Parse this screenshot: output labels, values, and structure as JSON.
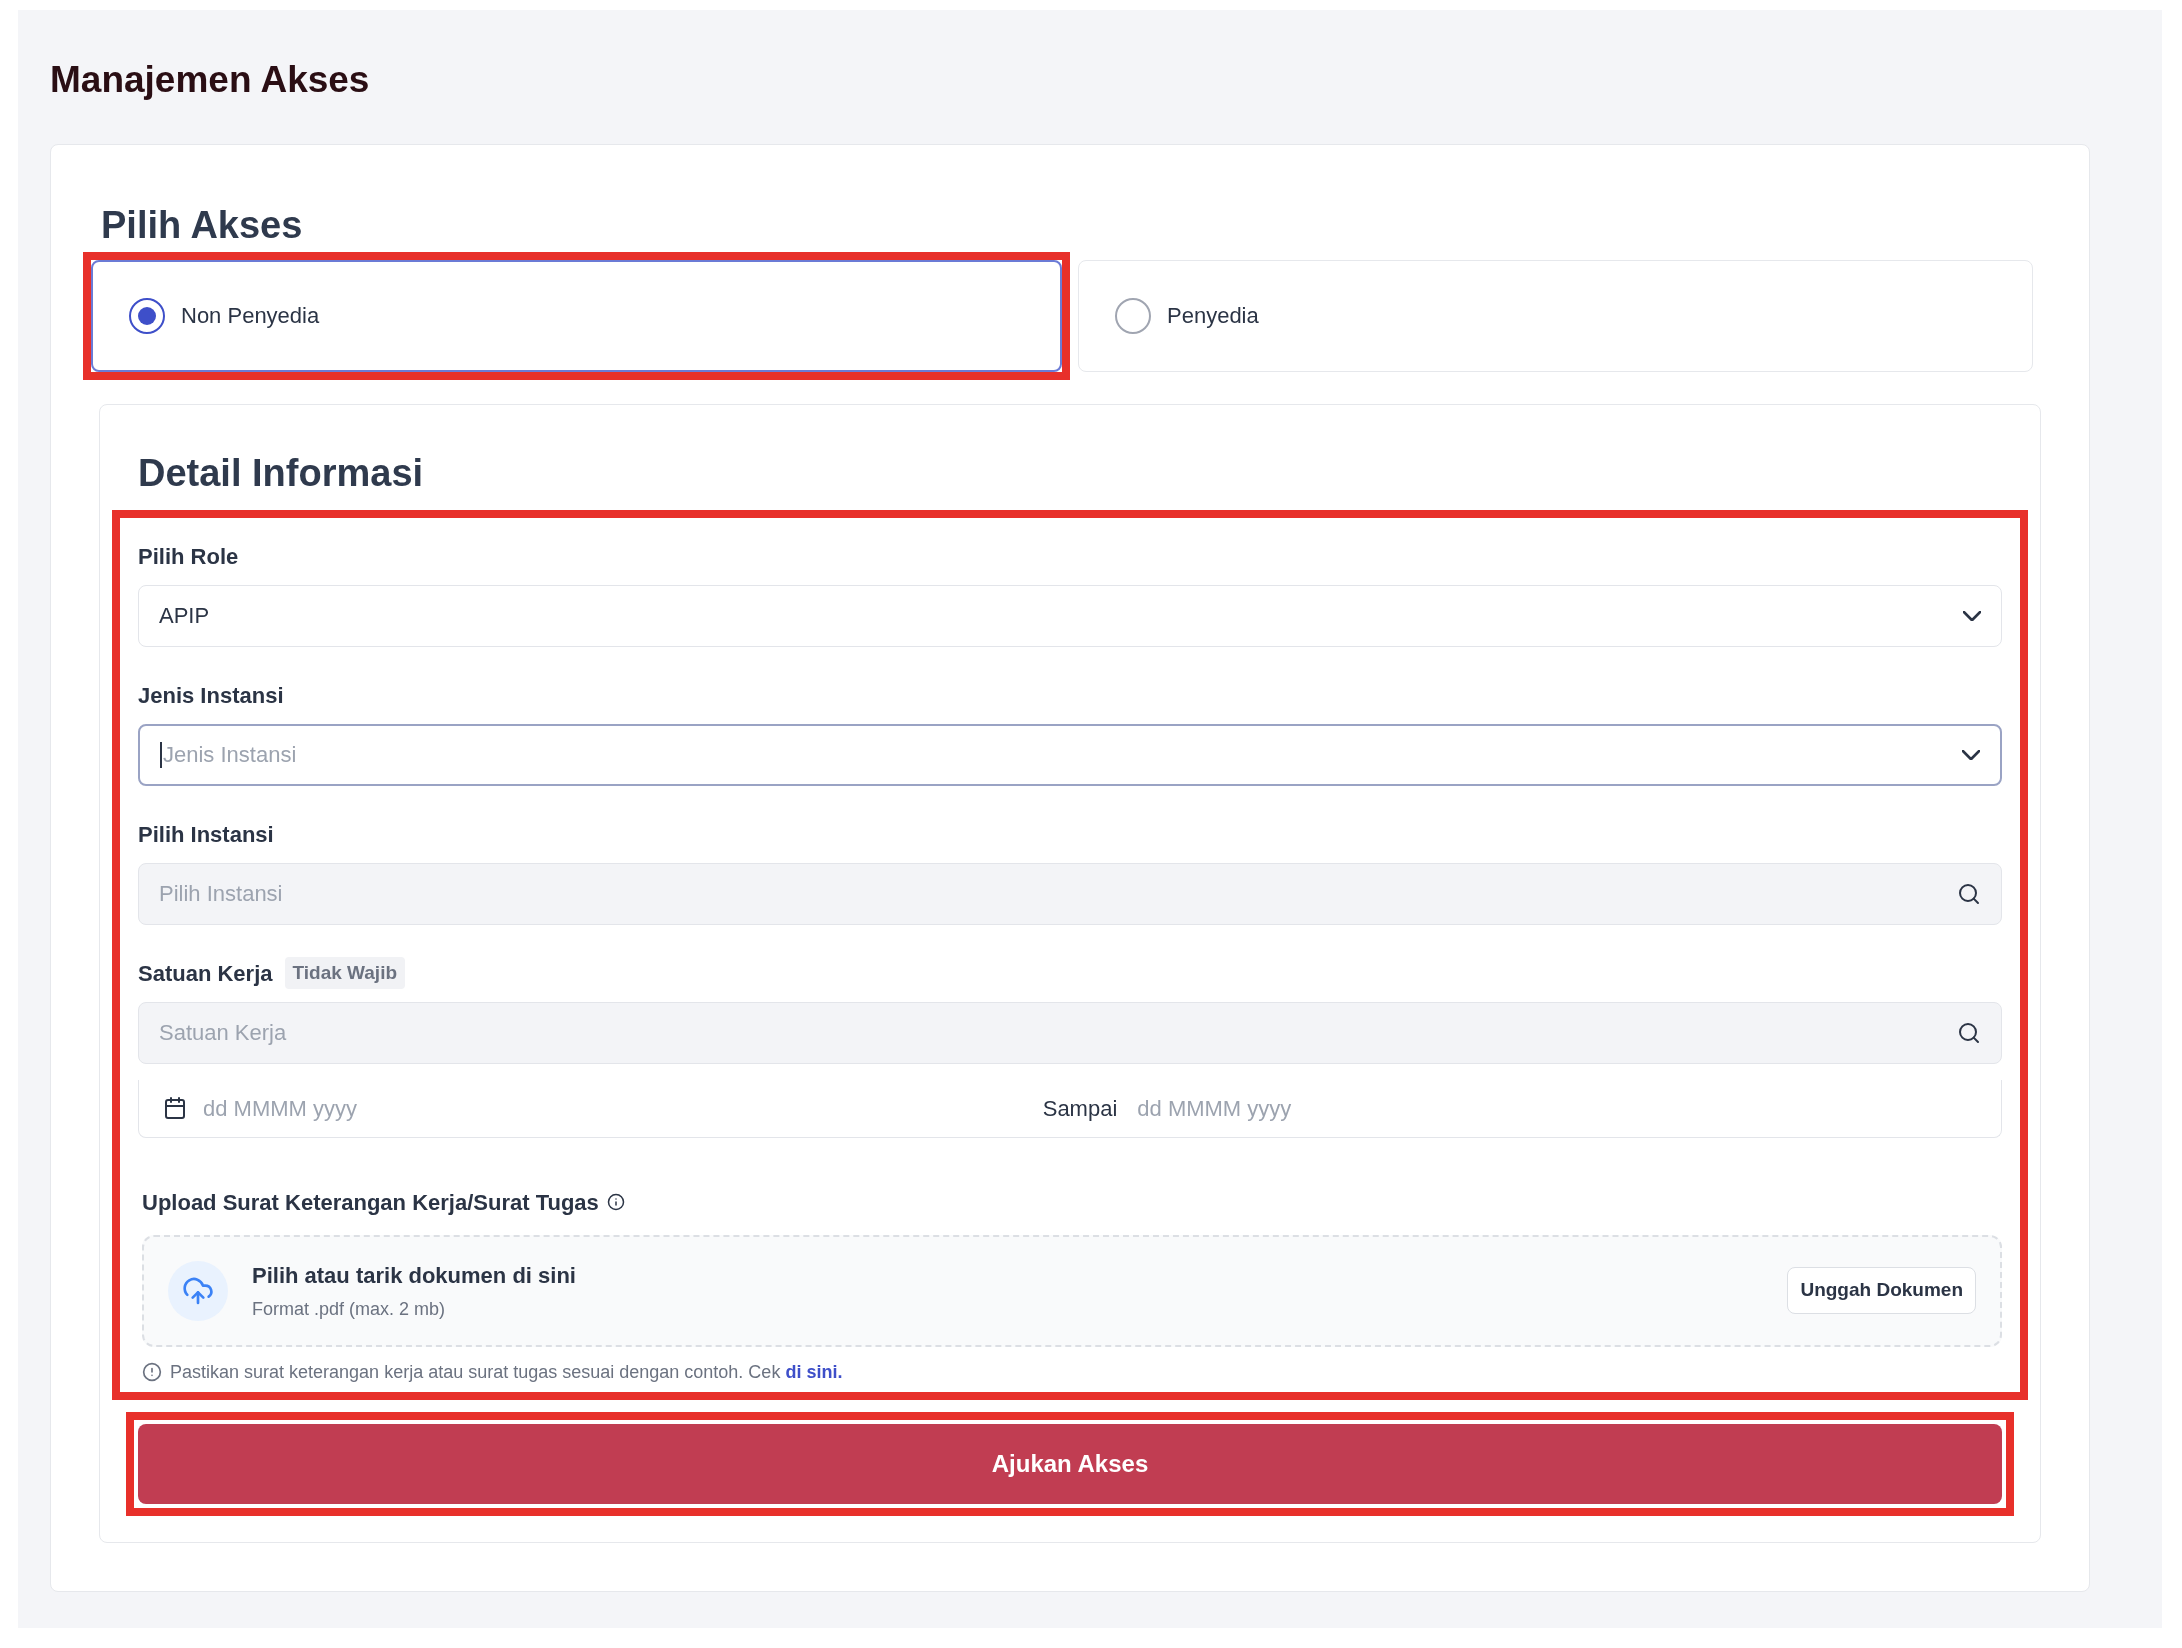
{
  "page_title": "Manajemen Akses",
  "access": {
    "title": "Pilih Akses",
    "options": [
      {
        "label": "Non Penyedia",
        "selected": true,
        "highlighted": true
      },
      {
        "label": "Penyedia",
        "selected": false,
        "highlighted": false
      }
    ]
  },
  "detail": {
    "title": "Detail Informasi",
    "highlighted": true,
    "fields": [
      {
        "kind": "select",
        "label": "Pilih Role",
        "value": "APIP",
        "focused": false
      },
      {
        "kind": "select",
        "label": "Jenis Instansi",
        "placeholder": "Jenis Instansi",
        "focused": true
      },
      {
        "kind": "search",
        "label": "Pilih Instansi",
        "placeholder": "Pilih Instansi",
        "focused": false
      },
      {
        "kind": "search",
        "label": "Satuan Kerja",
        "badge": "Tidak Wajib",
        "placeholder": "Satuan Kerja",
        "focused": false
      },
      {
        "kind": "daterange",
        "start_placeholder": "dd MMMM yyyy",
        "separator": "Sampai",
        "end_placeholder": "dd MMMM yyyy",
        "focused": false
      }
    ],
    "upload": {
      "label": "Upload Surat Keterangan Kerja/Surat Tugas",
      "title": "Pilih atau tarik dokumen di sini",
      "hint": "Format .pdf (max. 2 mb)",
      "button": "Unggah Dokumen"
    },
    "note": {
      "text": "Pastikan surat keterangan kerja atau surat tugas sesuai dengan contoh. Cek",
      "link": "di sini."
    }
  },
  "submit": {
    "label": "Ajukan Akses",
    "highlighted": true
  }
}
